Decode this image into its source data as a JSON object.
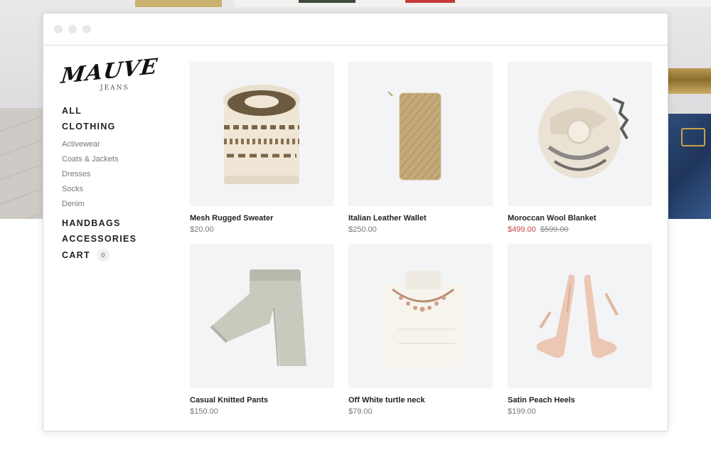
{
  "brand": {
    "name": "MAUVE",
    "sub": "JEANS"
  },
  "nav": {
    "all": "ALL",
    "clothing": "CLOTHING",
    "clothing_items": [
      "Activewear",
      "Coats & Jackets",
      "Dresses",
      "Socks",
      "Denim"
    ],
    "handbags": "HANDBAGS",
    "accessories": "ACCESSORIES",
    "cart": "CART",
    "cart_count": "0"
  },
  "products": [
    {
      "name": "Mesh Rugged Sweater",
      "price": "$20.00",
      "icon": "sweater-image"
    },
    {
      "name": "Italian Leather Wallet",
      "price": "$250.00",
      "icon": "wallet-image"
    },
    {
      "name": "Moroccan Wool Blanket",
      "sale_price": "$499.00",
      "original_price": "$599.00",
      "icon": "blanket-image"
    },
    {
      "name": "Casual Knitted Pants",
      "price": "$150.00",
      "icon": "pants-image"
    },
    {
      "name": "Off White turtle neck",
      "price": "$79.00",
      "icon": "turtleneck-image"
    },
    {
      "name": "Satin Peach Heels",
      "price": "$199.00",
      "icon": "heels-image"
    }
  ],
  "colors": {
    "sale": "#c8474a",
    "thumb_bg": "#f3f4f6",
    "text_dark": "#222222",
    "text_muted": "#777777"
  }
}
